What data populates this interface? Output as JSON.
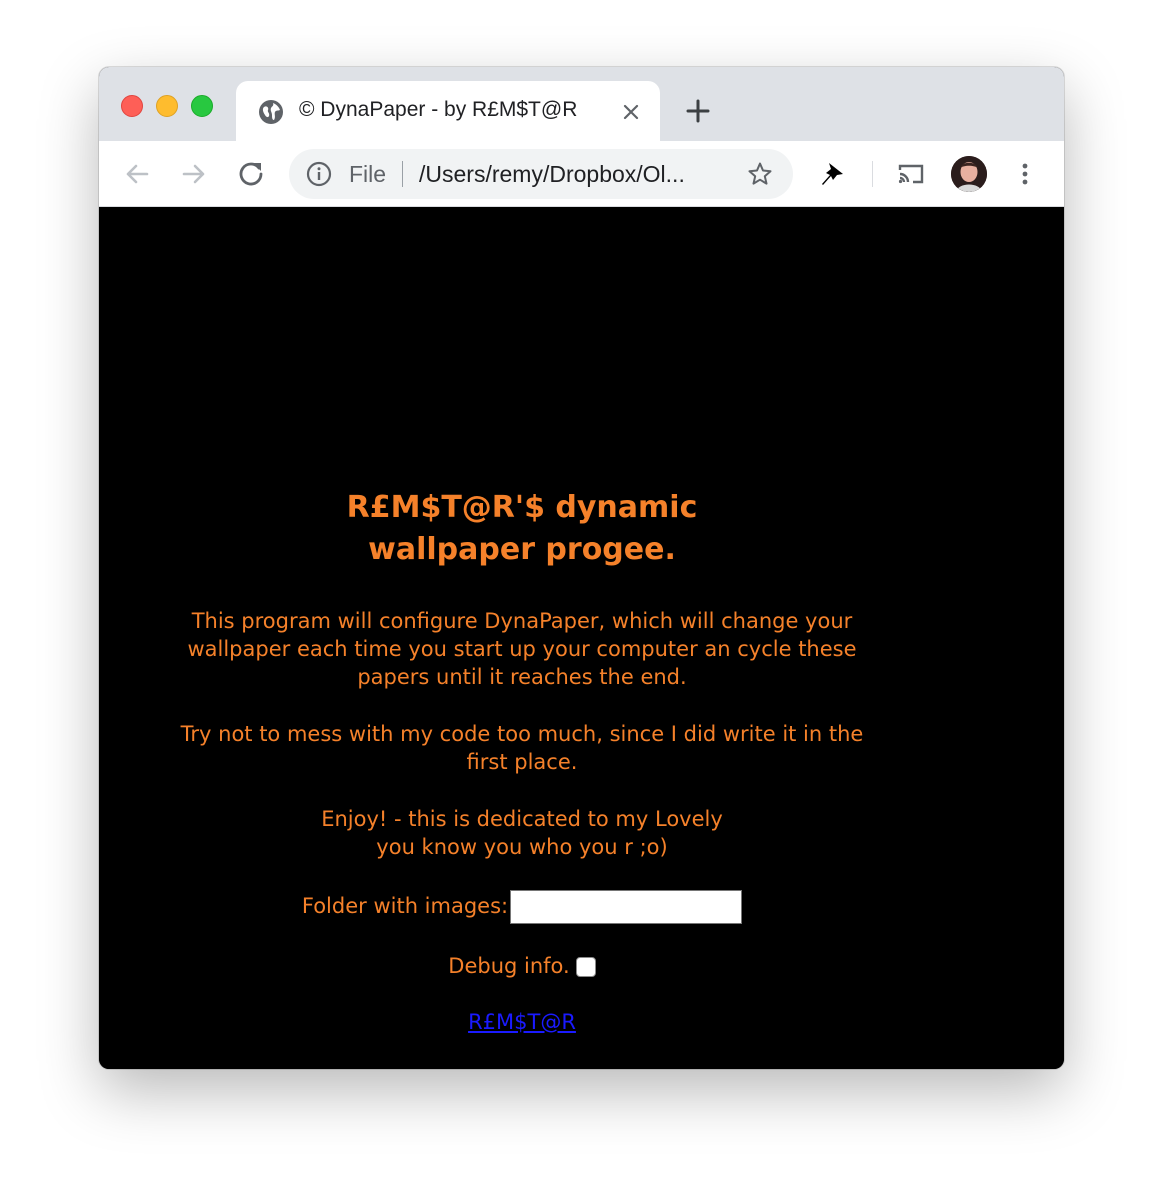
{
  "browser": {
    "tab_title": "© DynaPaper - by R£M$T@R",
    "omnibox": {
      "scheme_label": "File",
      "url": "/Users/remy/Dropbox/Ol..."
    },
    "icons": {
      "tab_favicon": "globe-icon",
      "tab_close": "close-icon",
      "new_tab": "plus-icon",
      "back": "arrow-left-icon",
      "forward": "arrow-right-icon",
      "reload": "reload-icon",
      "site_info": "info-icon",
      "bookmark": "star-icon",
      "extension": "pin-icon",
      "cast": "cast-icon",
      "menu": "kebab-menu-icon"
    },
    "colors": {
      "tabstrip": "#dee1e6",
      "traffic_close": "#fe5f57",
      "traffic_minimize": "#febc2e",
      "traffic_maximize": "#28c840"
    }
  },
  "page": {
    "heading_line1": "R£M$T@R'$ dynamic",
    "heading_line2": "wallpaper progee.",
    "intro_line1": "This program will configure DynaPaper, which will change your",
    "intro_line2": "wallpaper each time you start up your computer an cycle these",
    "intro_line3": "papers until it reaches the end.",
    "note_line1": "Try not to mess with my code too much, since I did write it in the",
    "note_line2": "first place.",
    "dedication_line1": "Enjoy! - this is dedicated to my Lovely",
    "dedication_line2": "you know you who you r ;o)",
    "folder_label": "Folder with images:",
    "folder_value": "",
    "debug_label": "Debug info.",
    "debug_checked": false,
    "link_text": "R£M$T@R",
    "colors": {
      "background": "#000000",
      "text": "#f5812a",
      "link": "#1a1aff"
    }
  }
}
